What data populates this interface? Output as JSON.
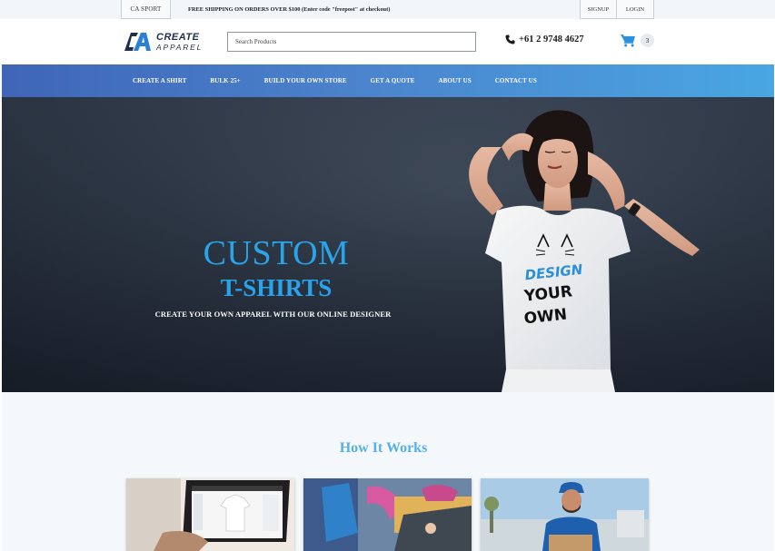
{
  "topbar": {
    "ca_sport": "CA SPORT",
    "shipping": "FREE SHIPPING ON ORDERS OVER $100 (Enter code \"freepost\" at checkout)",
    "signup": "SIGNUP",
    "login": "LOGIN"
  },
  "header": {
    "logo_line1": "CREATE",
    "logo_line2": "APPAREL",
    "search_placeholder": "Search Products",
    "phone": "+61 2 9748 4627",
    "cart_count": "3",
    "icons": [
      "phone-icon",
      "shopping-cart-icon"
    ]
  },
  "nav": {
    "items": [
      {
        "label": "CREATE A SHIRT"
      },
      {
        "label": "BULK 25+"
      },
      {
        "label": "BUILD YOUR OWN STORE"
      },
      {
        "label": "GET A QUOTE"
      },
      {
        "label": "ABOUT US"
      },
      {
        "label": "CONTACT US"
      }
    ]
  },
  "hero": {
    "title_line1": "CUSTOM",
    "title_line2": "T-SHIRTS",
    "subtitle": "CREATE YOUR OWN APPAREL WITH OUR ONLINE DESIGNER",
    "shirt_print": [
      "DESIGN",
      "YOUR",
      "OWN"
    ]
  },
  "how": {
    "heading": "How It Works",
    "cards": [
      "laptop-designer-photo",
      "screen-printing-photo",
      "delivery-courier-photo"
    ]
  },
  "colors": {
    "accent_blue": "#29a3ea",
    "nav_start": "#3f65b7",
    "nav_end": "#49a6e3",
    "heading_blue": "#58afe6"
  }
}
